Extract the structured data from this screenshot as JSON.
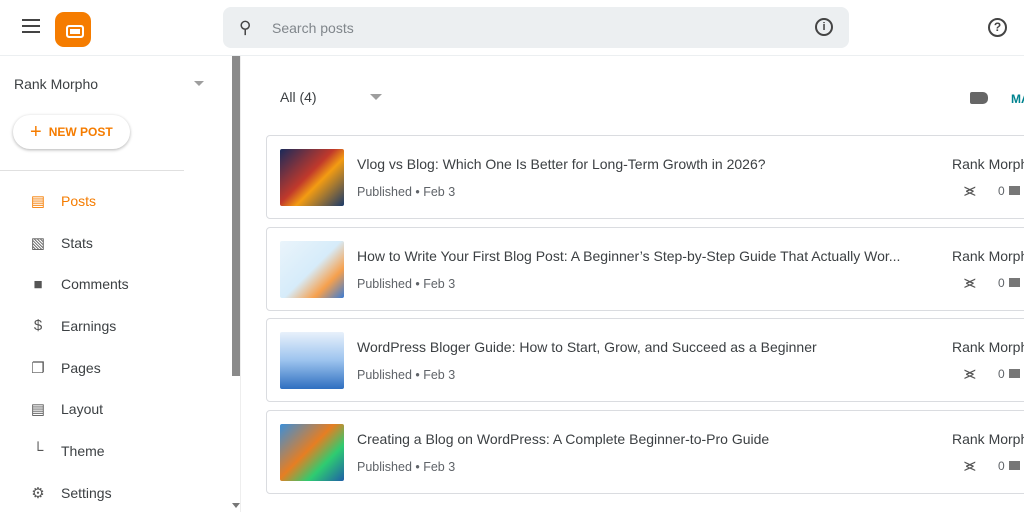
{
  "header": {
    "search_placeholder": "Search posts"
  },
  "sidebar": {
    "blog_name": "Rank Morpho",
    "new_post_label": "NEW POST",
    "items": [
      {
        "label": "Posts",
        "icon": "posts-icon",
        "active": true
      },
      {
        "label": "Stats",
        "icon": "stats-icon"
      },
      {
        "label": "Comments",
        "icon": "comments-icon"
      },
      {
        "label": "Earnings",
        "icon": "dollar-icon"
      },
      {
        "label": "Pages",
        "icon": "pages-icon"
      },
      {
        "label": "Layout",
        "icon": "layout-icon"
      },
      {
        "label": "Theme",
        "icon": "paint-roller-icon"
      },
      {
        "label": "Settings",
        "icon": "gear-icon"
      }
    ]
  },
  "main": {
    "filter_label": "All (4)",
    "manage_label": "MA",
    "posts": [
      {
        "title": "Vlog vs Blog: Which One Is Better for Long-Term Growth in 2026?",
        "status": "Published • Feb 3",
        "author": "Rank Morph",
        "comments": "0"
      },
      {
        "title": "How to Write Your First Blog Post: A Beginner’s Step-by-Step Guide That Actually Wor...",
        "status": "Published • Feb 3",
        "author": "Rank Morph",
        "comments": "0"
      },
      {
        "title": "WordPress Bloger Guide: How to Start, Grow, and Succeed as a Beginner",
        "status": "Published • Feb 3",
        "author": "Rank Morph",
        "comments": "0"
      },
      {
        "title": "Creating a Blog on WordPress: A Complete Beginner-to-Pro Guide",
        "status": "Published • Feb 3",
        "author": "Rank Morph",
        "comments": "0"
      }
    ]
  },
  "colors": {
    "accent": "#f57c00",
    "manage": "#00838f"
  }
}
